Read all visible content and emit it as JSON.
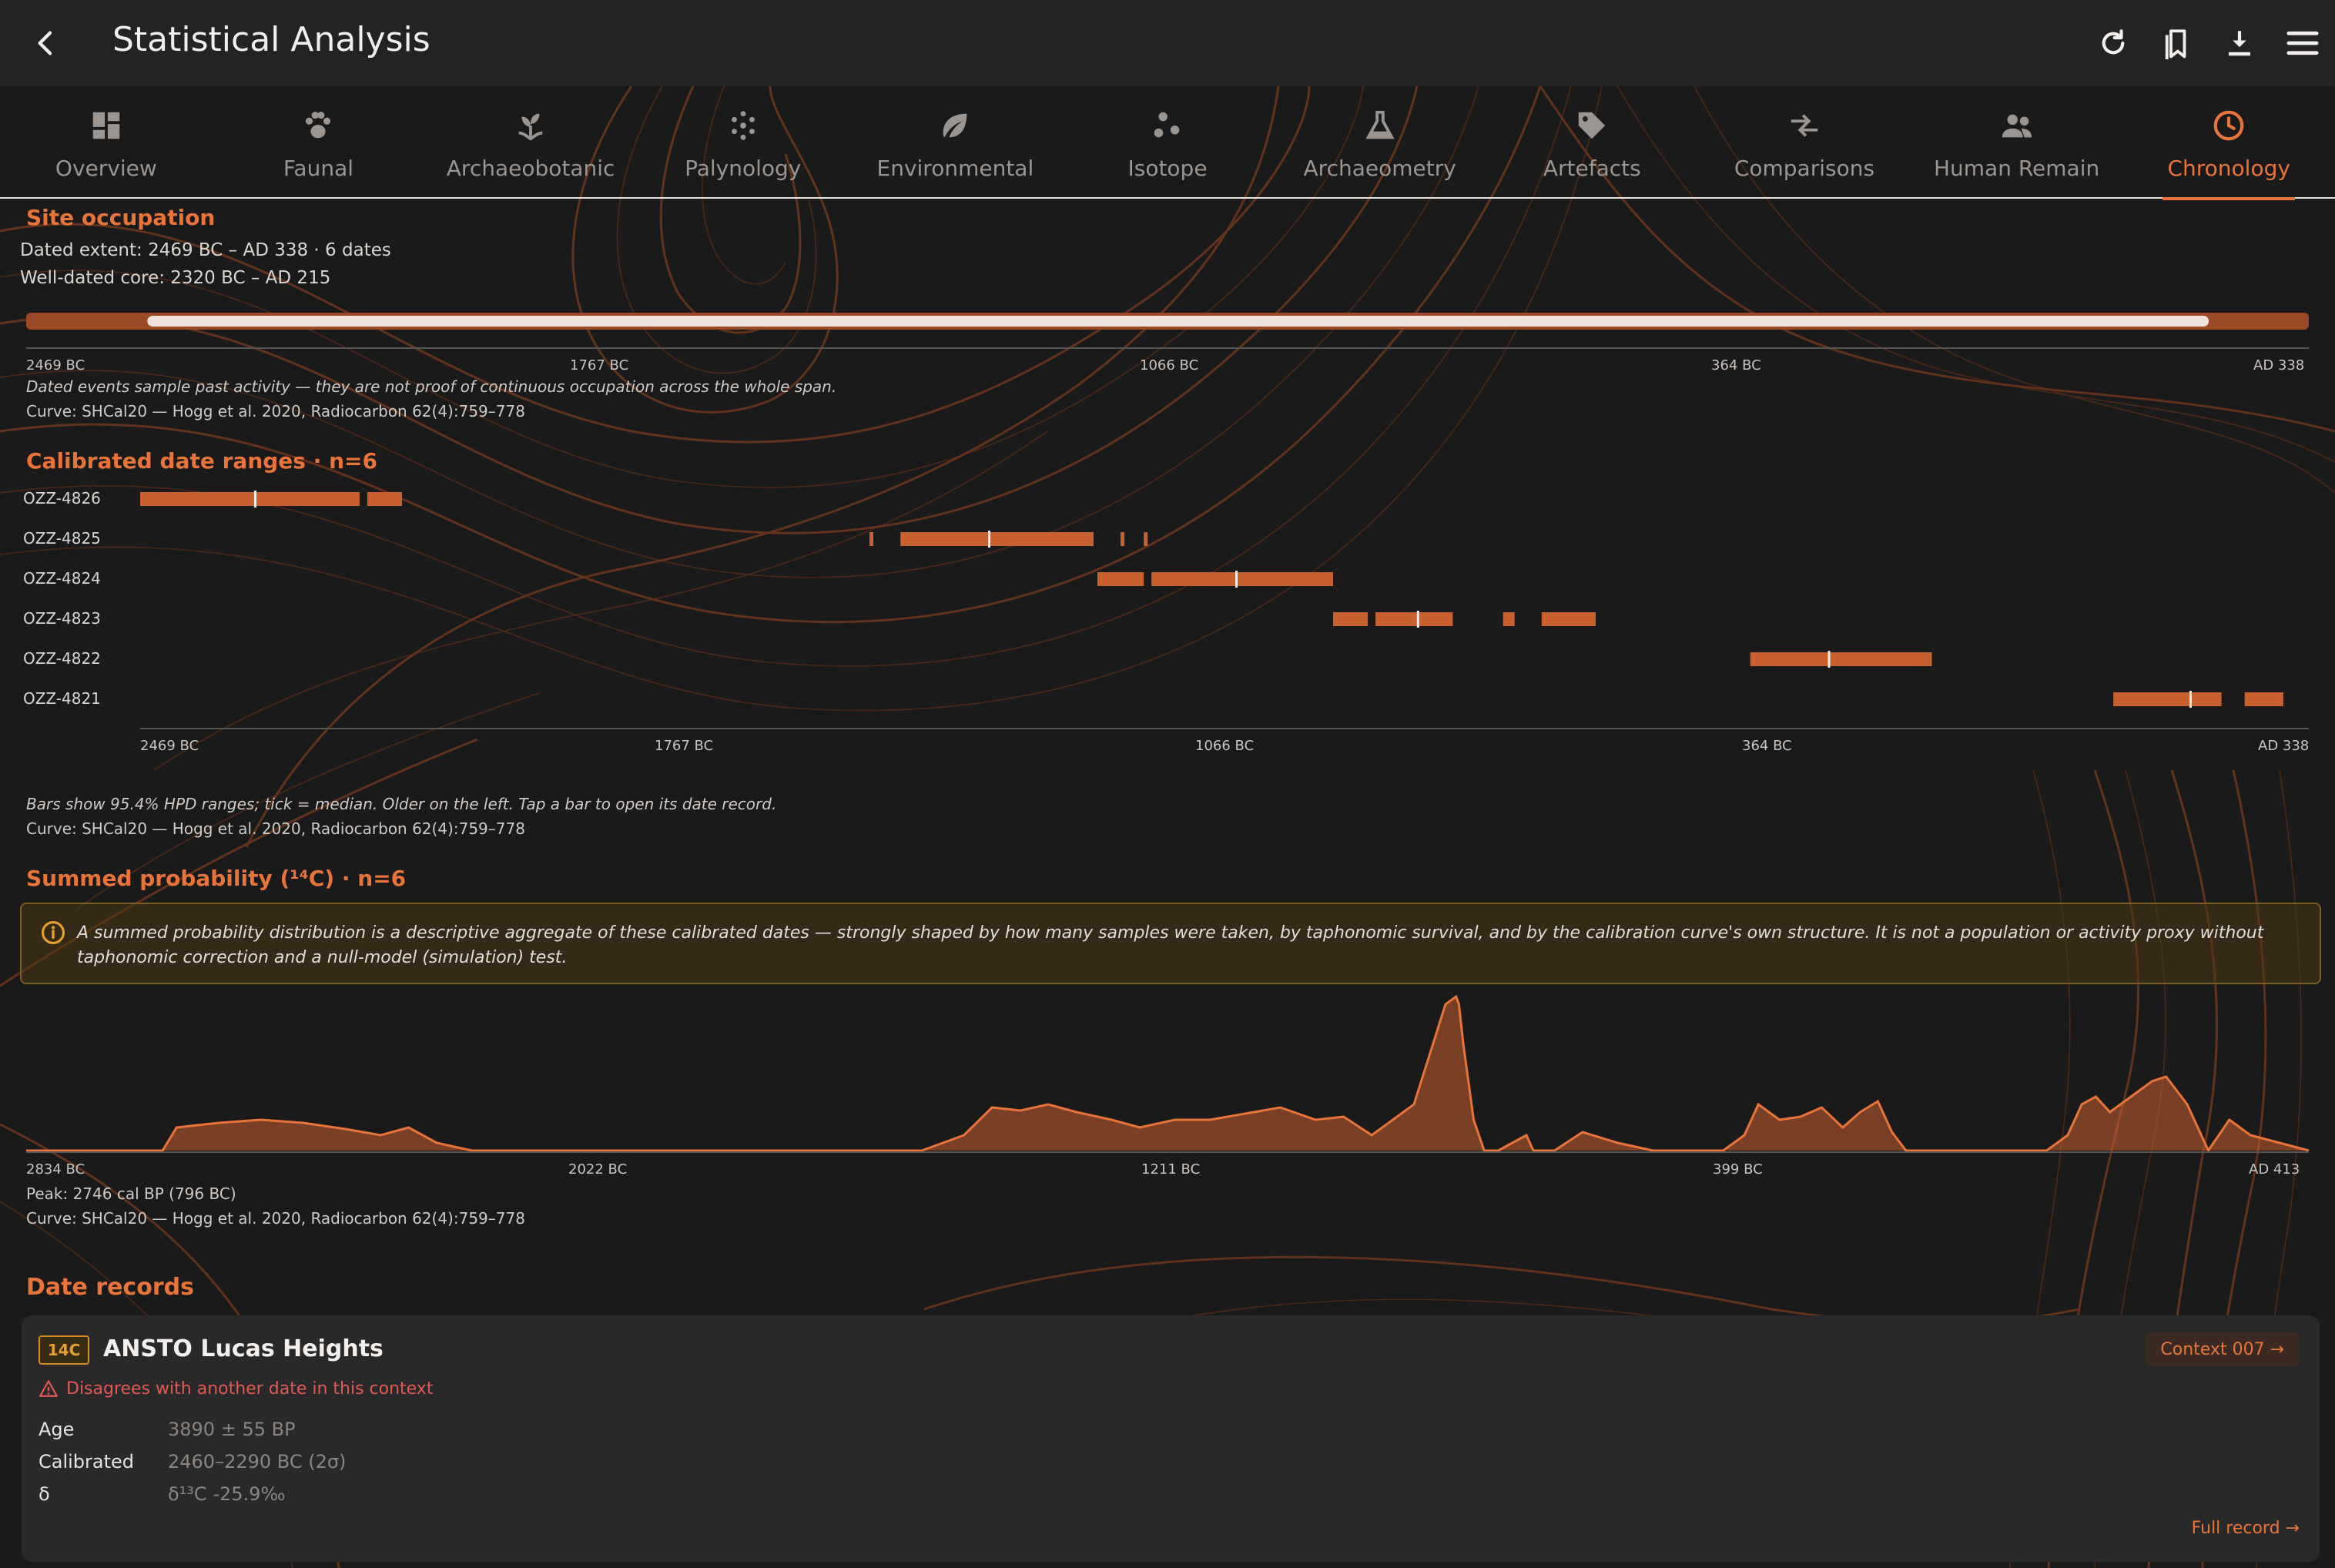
{
  "app": {
    "title": "Statistical Analysis"
  },
  "icons": {
    "back": "chevron-left-icon",
    "actions": [
      "refresh-icon",
      "bookmarks-icon",
      "download-icon",
      "menu-icon"
    ]
  },
  "tabs": [
    {
      "label": "Overview",
      "icon": "grid-icon"
    },
    {
      "label": "Faunal",
      "icon": "paw-icon"
    },
    {
      "label": "Archaeobotanic",
      "icon": "sprout-icon"
    },
    {
      "label": "Palynology",
      "icon": "pollen-icon"
    },
    {
      "label": "Environmental",
      "icon": "leaf-icon"
    },
    {
      "label": "Isotope",
      "icon": "dots-icon"
    },
    {
      "label": "Archaeometry",
      "icon": "flask-icon"
    },
    {
      "label": "Artefacts",
      "icon": "tag-icon"
    },
    {
      "label": "Comparisons",
      "icon": "compare-icon"
    },
    {
      "label": "Human Remain",
      "icon": "people-icon"
    },
    {
      "label": "Chronology",
      "icon": "clock-icon",
      "active": true
    }
  ],
  "colors": {
    "accent": "#e8743a",
    "bar": "#c8602f",
    "background": "#1b1a1a"
  },
  "occupation": {
    "title": "Site occupation",
    "extent": "Dated extent: 2469 BC – AD 338 · 6 dates",
    "core": "Well-dated core: 2320 BC – AD 215",
    "ticks": [
      "2469 BC",
      "1767 BC",
      "1066 BC",
      "364 BC",
      "AD 338"
    ],
    "note": "Dated events sample past activity — they are not proof of continuous occupation across the whole span.",
    "curve": "Curve: SHCal20 — Hogg et al. 2020, Radiocarbon 62(4):759–778",
    "extent_range": [
      -2469,
      338
    ],
    "core_range": [
      -2320,
      215
    ]
  },
  "calibrated": {
    "title": "Calibrated date ranges · n=6",
    "ticks": [
      "2469 BC",
      "1767 BC",
      "1066 BC",
      "364 BC",
      "AD 338"
    ],
    "note": "Bars show 95.4% HPD ranges; tick = median. Older on the left. Tap a bar to open its date record.",
    "curve": "Curve: SHCal20 — Hogg et al. 2020, Radiocarbon 62(4):759–778"
  },
  "summed": {
    "title": "Summed probability (¹⁴C) · n=6",
    "warning": "A summed probability distribution is a descriptive aggregate of these calibrated dates — strongly shaped by how many samples were taken, by taphonomic survival, and by the calibration curve's own structure. It is not a population or activity proxy without taphonomic correction and a null-model (simulation) test.",
    "ticks": [
      "2834 BC",
      "2022 BC",
      "1211 BC",
      "399 BC",
      "AD 413"
    ],
    "peak": "Peak: 2746 cal BP (796 BC)",
    "curve": "Curve: SHCal20 — Hogg et al. 2020, Radiocarbon 62(4):759–778"
  },
  "records": {
    "title": "Date records",
    "card": {
      "badge": "14C",
      "lab": "ANSTO Lucas Heights",
      "context": "Context 007 →",
      "warning": "Disagrees with another date in this context",
      "rows": [
        {
          "k": "Age",
          "v": "3890 ± 55 BP"
        },
        {
          "k": "Calibrated",
          "v": "2460–2290 BC (2σ)"
        },
        {
          "k": "δ",
          "v": "δ¹³C -25.9‰"
        }
      ],
      "full": "Full record →"
    }
  },
  "chart_data": [
    {
      "type": "bar",
      "title": "Calibrated date ranges · n=6",
      "x_range": [
        -2469,
        338
      ],
      "series": [
        {
          "name": "OZZ-4826",
          "ranges": [
            [
              -2469,
              -2185
            ],
            [
              -2175,
              -2130
            ]
          ],
          "median": -2320
        },
        {
          "name": "OZZ-4825",
          "ranges": [
            [
              -1525,
              -1520
            ],
            [
              -1485,
              -1235
            ],
            [
              -1200,
              -1197
            ],
            [
              -1170,
              -1165
            ]
          ],
          "median": -1370
        },
        {
          "name": "OZZ-4824",
          "ranges": [
            [
              -1230,
              -1170
            ],
            [
              -1160,
              -925
            ]
          ],
          "median": -1050
        },
        {
          "name": "OZZ-4823",
          "ranges": [
            [
              -925,
              -880
            ],
            [
              -870,
              -770
            ],
            [
              -705,
              -690
            ],
            [
              -655,
              -585
            ]
          ],
          "median": -815
        },
        {
          "name": "OZZ-4822",
          "ranges": [
            [
              -385,
              -150
            ]
          ],
          "median": -283
        },
        {
          "name": "OZZ-4821",
          "ranges": [
            [
              85,
              225
            ],
            [
              255,
              305
            ]
          ],
          "median": 185
        }
      ]
    },
    {
      "type": "area",
      "title": "Summed probability (¹⁴C) · n=6",
      "x_range": [
        -2834,
        413
      ],
      "x": [
        -2834,
        -2640,
        -2620,
        -2560,
        -2500,
        -2440,
        -2380,
        -2330,
        -2290,
        -2250,
        -2200,
        -2150,
        -2100,
        -2000,
        -1700,
        -1560,
        -1500,
        -1460,
        -1420,
        -1380,
        -1340,
        -1290,
        -1250,
        -1200,
        -1150,
        -1100,
        -1050,
        -1000,
        -960,
        -920,
        -860,
        -815,
        -800,
        -796,
        -790,
        -775,
        -760,
        -740,
        -700,
        -690,
        -660,
        -620,
        -570,
        -520,
        -420,
        -390,
        -370,
        -340,
        -310,
        -280,
        -250,
        -225,
        -200,
        -180,
        -160,
        -120,
        -90,
        -20,
        40,
        70,
        90,
        110,
        130,
        160,
        190,
        210,
        240,
        270,
        300,
        330,
        413
      ],
      "values": [
        0,
        0,
        0.15,
        0.18,
        0.2,
        0.18,
        0.14,
        0.1,
        0.15,
        0.05,
        0,
        0,
        0,
        0,
        0,
        0,
        0.1,
        0.28,
        0.26,
        0.3,
        0.25,
        0.2,
        0.15,
        0.2,
        0.2,
        0.24,
        0.28,
        0.2,
        0.22,
        0.1,
        0.3,
        0.95,
        1.0,
        0.95,
        0.7,
        0.2,
        0,
        0,
        0.1,
        0,
        0,
        0.12,
        0.05,
        0,
        0,
        0.1,
        0.3,
        0.2,
        0.22,
        0.28,
        0.15,
        0.25,
        0.32,
        0.12,
        0,
        0,
        0,
        0,
        0,
        0.1,
        0.3,
        0.35,
        0.25,
        0.35,
        0.45,
        0.48,
        0.3,
        0,
        0.2,
        0.1,
        0
      ]
    }
  ]
}
